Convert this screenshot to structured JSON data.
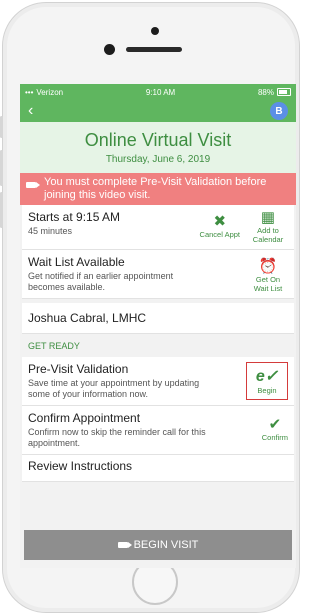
{
  "status_bar": {
    "carrier": "Verizon",
    "time": "9:10 AM",
    "battery": "88%"
  },
  "nav": {
    "back_icon": "‹",
    "avatar_initial": "B"
  },
  "header": {
    "title": "Online Virtual Visit",
    "date": "Thursday, June 6, 2019"
  },
  "warning": {
    "text": "You must complete Pre-Visit Validation before joining this video visit."
  },
  "appointment": {
    "start": "Starts at 9:15 AM",
    "duration": "45 minutes",
    "cancel_label": "Cancel Appt",
    "calendar_label": "Add to Calendar"
  },
  "wait_list": {
    "title": "Wait List Available",
    "description": "Get notified if an earlier appointment becomes available.",
    "action_label": "Get On Wait List"
  },
  "provider": {
    "name": "Joshua Cabral, LMHC"
  },
  "section": {
    "label": "GET READY"
  },
  "pre_visit": {
    "title": "Pre-Visit Validation",
    "description": "Save time at your appointment by updating some of your information now.",
    "action_label": "Begin"
  },
  "confirm": {
    "title": "Confirm Appointment",
    "description": "Confirm now to skip the reminder call for this appointment.",
    "action_label": "Confirm"
  },
  "instructions": {
    "title": "Review Instructions"
  },
  "begin_visit": {
    "label": "BEGIN VISIT"
  },
  "colors": {
    "accent": "#5fb65f",
    "accent_text": "#3e8e41",
    "warning": "#f08080",
    "begin_border": "#d43b3b",
    "begin_visit_bg": "#8e8e8e"
  }
}
